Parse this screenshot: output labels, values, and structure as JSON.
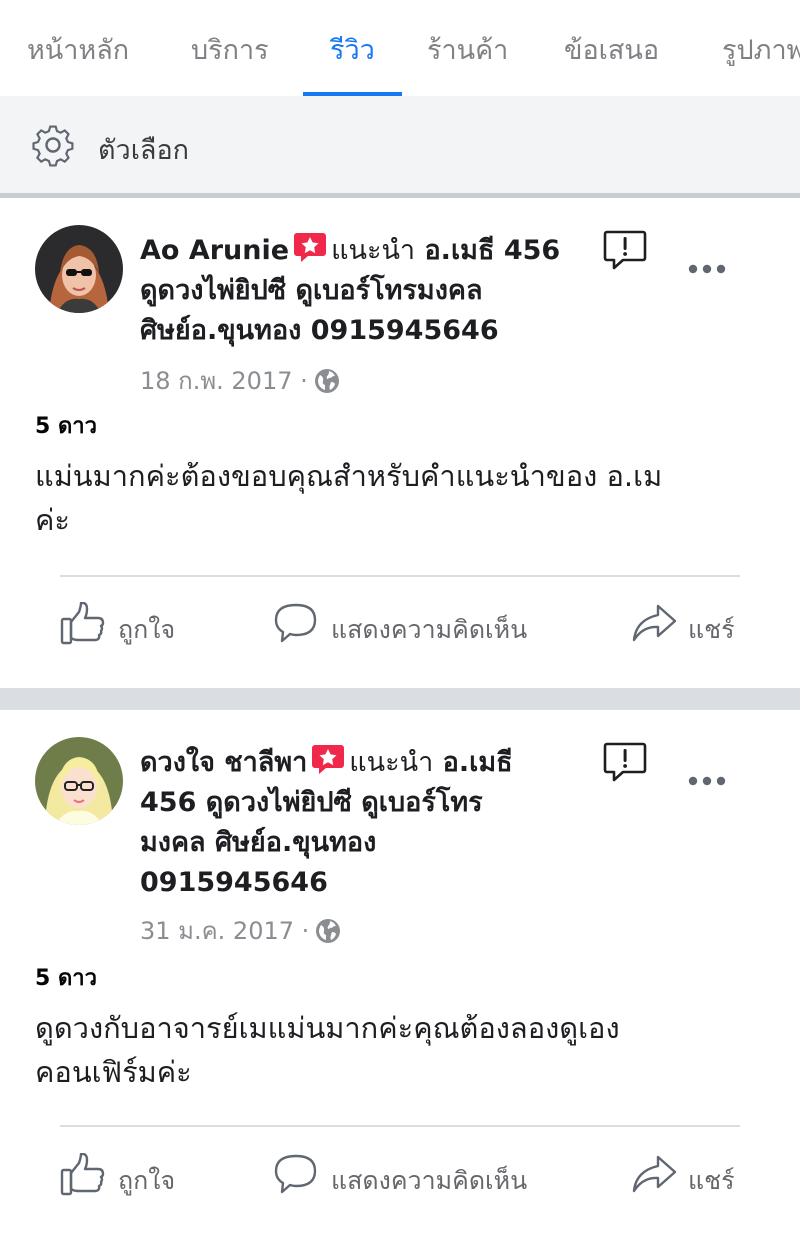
{
  "tabs": [
    {
      "label": "หน้าหลัก",
      "active": false
    },
    {
      "label": "บริการ",
      "active": false
    },
    {
      "label": "รีวิว",
      "active": true
    },
    {
      "label": "ร้านค้า",
      "active": false
    },
    {
      "label": "ข้อเสนอ",
      "active": false
    },
    {
      "label": "รูปภาพ",
      "active": false
    }
  ],
  "options": {
    "label": "ตัวเลือก",
    "icon": "gear-icon"
  },
  "posts": [
    {
      "author": "Ao Arunie",
      "recommend_word": "แนะนำ",
      "page_name": "อ.เมธี 456 ดูดวงไพ่ยิปซี ดูเบอร์โทรมงคล ศิษย์อ.ขุนทอง 0915945646",
      "header_lines": [
        "ดูดวงไพ่ยิปซี ดูเบอร์โทรมงคล",
        "ศิษย์อ.ขุนทอง 0915945646"
      ],
      "header_first_bold": "อ.เมธี 456",
      "date": "18 ก.พ. 2017 ·",
      "rating": "5 ดาว",
      "text": "แม่นมากค่ะต้องขอบคุณสำหรับคำแนะนำของ อ.เม ค่ะ",
      "text_lines": [
        "แม่นมากค่ะต้องขอบคุณสำหรับคำแนะนำของ อ.เม",
        "ค่ะ"
      ]
    },
    {
      "author": "ดวงใจ ชาลีพา",
      "recommend_word": "แนะนำ",
      "page_name": "อ.เมธี 456 ดูดวงไพ่ยิปซี ดูเบอร์โทร มงคล ศิษย์อ.ขุนทอง 0915945646",
      "header_first_bold": "อ.เมธี",
      "header_lines": [
        "456 ดูดวงไพ่ยิปซี ดูเบอร์โทร",
        "มงคล ศิษย์อ.ขุนทอง",
        "0915945646"
      ],
      "date": "31 ม.ค. 2017 ·",
      "rating": "5 ดาว",
      "text": "ดูดวงกับอาจารย์เมแม่นมากค่ะคุณต้องลองดูเอง คอนเฟิร์มค่ะ",
      "text_lines": [
        "ดูดวงกับอาจารย์เมแม่นมากค่ะคุณต้องลองดูเอง",
        "คอนเฟิร์มค่ะ"
      ]
    }
  ],
  "actions": {
    "like": "ถูกใจ",
    "comment": "แสดงความคิดเห็น",
    "share": "แชร์"
  },
  "colors": {
    "accent": "#1877f2",
    "badge": "#f02849",
    "muted": "#65676b"
  }
}
